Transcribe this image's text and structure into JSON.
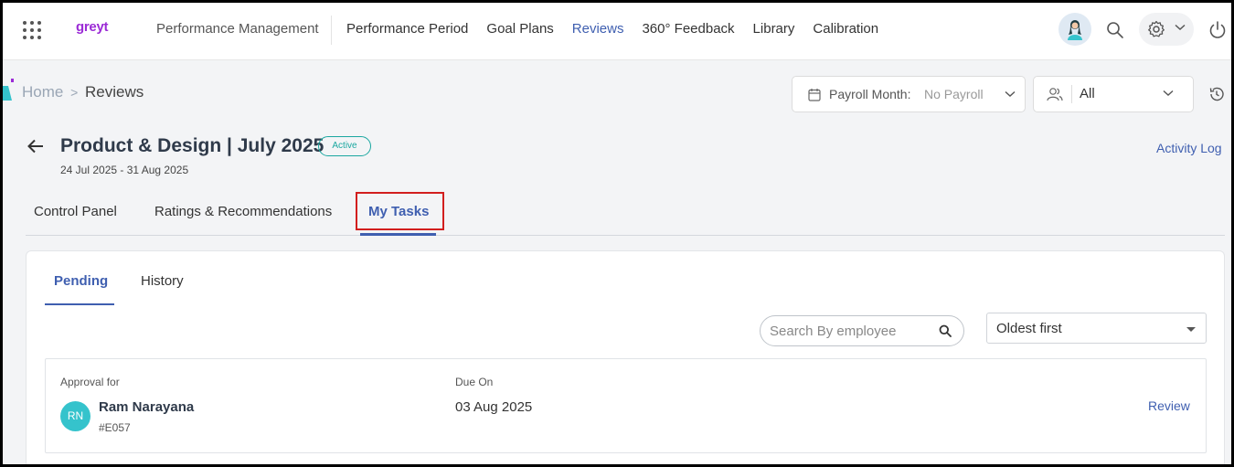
{
  "topnav": {
    "logo": "greyt",
    "module": "Performance Management",
    "items": [
      {
        "label": "Performance Period",
        "active": false
      },
      {
        "label": "Goal Plans",
        "active": false
      },
      {
        "label": "Reviews",
        "active": true
      },
      {
        "label": "360° Feedback",
        "active": false
      },
      {
        "label": "Library",
        "active": false
      },
      {
        "label": "Calibration",
        "active": false
      }
    ]
  },
  "breadcrumb": {
    "home": "Home",
    "separator": ">",
    "current": "Reviews"
  },
  "filters": {
    "payroll_label": "Payroll Month:",
    "payroll_value": "No Payroll",
    "people_value": "All"
  },
  "review": {
    "title": "Product & Design | July 2025",
    "status": "Active",
    "date_range": "24 Jul 2025 - 31 Aug 2025",
    "activity_log": "Activity Log"
  },
  "main_tabs": [
    {
      "label": "Control Panel",
      "active": false
    },
    {
      "label": "Ratings & Recommendations",
      "active": false
    },
    {
      "label": "My Tasks",
      "active": true
    }
  ],
  "sub_tabs": [
    {
      "label": "Pending",
      "active": true
    },
    {
      "label": "History",
      "active": false
    }
  ],
  "search": {
    "placeholder": "Search By employee",
    "value": ""
  },
  "sort": {
    "selected": "Oldest first"
  },
  "tasks": {
    "columns": {
      "approval": "Approval for",
      "due": "Due On"
    },
    "rows": [
      {
        "initials": "RN",
        "name": "Ram Narayana",
        "code": "#E057",
        "due_on": "03 Aug 2025",
        "action": "Review"
      }
    ]
  },
  "colors": {
    "accent": "#3f5fb0",
    "brand": "#9b2bd6",
    "status_active": "#1aa7a0",
    "avatar_bg": "#35c3cc",
    "highlight": "#d21e1e"
  }
}
